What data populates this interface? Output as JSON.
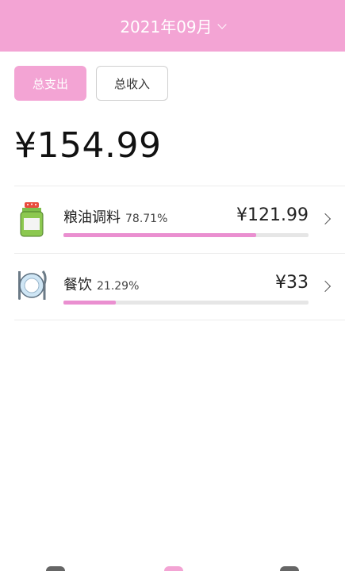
{
  "header": {
    "month_label": "2021年09月"
  },
  "tabs": [
    {
      "label": "总支出",
      "active": true
    },
    {
      "label": "总收入",
      "active": false
    }
  ],
  "total": "¥154.99",
  "categories": [
    {
      "name": "粮油调料",
      "percent": "78.71%",
      "amount": "¥121.99",
      "fraction": 0.7871,
      "icon": "seasoning-jar-icon"
    },
    {
      "name": "餐饮",
      "percent": "21.29%",
      "amount": "¥33",
      "fraction": 0.2129,
      "icon": "plate-cutlery-icon"
    }
  ],
  "colors": {
    "accent": "#f3a4d4",
    "bar_fill": "#ea8fd0",
    "bar_track": "#e6e6e6"
  }
}
